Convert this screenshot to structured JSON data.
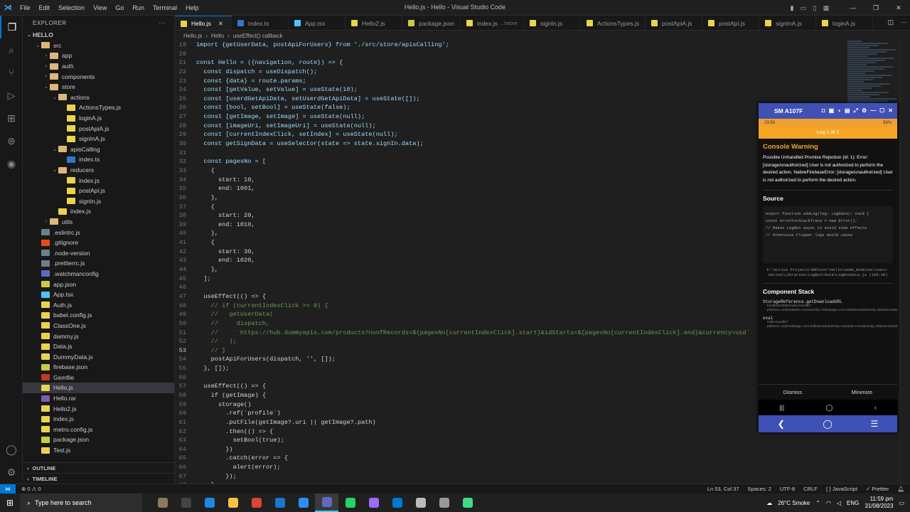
{
  "window": {
    "title": "Hello.js - Hello - Visual Studio Code",
    "menu": [
      "File",
      "Edit",
      "Selection",
      "View",
      "Go",
      "Run",
      "Terminal",
      "Help"
    ]
  },
  "explorer": {
    "header": "EXPLORER",
    "root": "HELLO",
    "items": [
      {
        "label": "src",
        "depth": 1,
        "type": "folder",
        "chev": "⌄"
      },
      {
        "label": "app",
        "depth": 2,
        "type": "folder",
        "chev": "›"
      },
      {
        "label": "auth",
        "depth": 2,
        "type": "folder",
        "chev": "›"
      },
      {
        "label": "components",
        "depth": 2,
        "type": "folder",
        "chev": "›"
      },
      {
        "label": "store",
        "depth": 2,
        "type": "folder",
        "chev": "⌄"
      },
      {
        "label": "actions",
        "depth": 3,
        "type": "folder",
        "chev": "⌄"
      },
      {
        "label": "ActionsTypes.js",
        "depth": 4,
        "type": "js"
      },
      {
        "label": "loginA.js",
        "depth": 4,
        "type": "js"
      },
      {
        "label": "postApiA.js",
        "depth": 4,
        "type": "js"
      },
      {
        "label": "signInA.js",
        "depth": 4,
        "type": "js"
      },
      {
        "label": "apisCalling",
        "depth": 3,
        "type": "folder",
        "chev": "⌄"
      },
      {
        "label": "index.ts",
        "depth": 4,
        "type": "ts"
      },
      {
        "label": "reducers",
        "depth": 3,
        "type": "folder",
        "chev": "⌄"
      },
      {
        "label": "index.js",
        "depth": 4,
        "type": "js"
      },
      {
        "label": "postApi.js",
        "depth": 4,
        "type": "js"
      },
      {
        "label": "signIn.js",
        "depth": 4,
        "type": "js"
      },
      {
        "label": "index.js",
        "depth": 3,
        "type": "js"
      },
      {
        "label": "utils",
        "depth": 2,
        "type": "folder",
        "chev": "›"
      },
      {
        "label": ".eslintrc.js",
        "depth": 1,
        "type": "cfg"
      },
      {
        "label": ".gitignore",
        "depth": 1,
        "type": "git"
      },
      {
        "label": ".node-version",
        "depth": 1,
        "type": "cfg"
      },
      {
        "label": ".prettierrc.js",
        "depth": 1,
        "type": "cfg"
      },
      {
        "label": ".watchmanconfig",
        "depth": 1,
        "type": "watch"
      },
      {
        "label": "app.json",
        "depth": 1,
        "type": "json"
      },
      {
        "label": "App.tsx",
        "depth": 1,
        "type": "tsx"
      },
      {
        "label": "Auth.js",
        "depth": 1,
        "type": "js"
      },
      {
        "label": "babel.config.js",
        "depth": 1,
        "type": "js"
      },
      {
        "label": "ClassOne.js",
        "depth": 1,
        "type": "js"
      },
      {
        "label": "dammy.js",
        "depth": 1,
        "type": "js"
      },
      {
        "label": "Data.js",
        "depth": 1,
        "type": "js"
      },
      {
        "label": "DummyData.js",
        "depth": 1,
        "type": "js"
      },
      {
        "label": "firebase.json",
        "depth": 1,
        "type": "json"
      },
      {
        "label": "Gemfile",
        "depth": 1,
        "type": "gem"
      },
      {
        "label": "Hello.js",
        "depth": 1,
        "type": "js",
        "selected": true
      },
      {
        "label": "Hello.rar",
        "depth": 1,
        "type": "rar"
      },
      {
        "label": "Hello2.js",
        "depth": 1,
        "type": "js"
      },
      {
        "label": "index.js",
        "depth": 1,
        "type": "js"
      },
      {
        "label": "metro.config.js",
        "depth": 1,
        "type": "js"
      },
      {
        "label": "package.json",
        "depth": 1,
        "type": "json"
      },
      {
        "label": "Test.js",
        "depth": 1,
        "type": "js"
      }
    ],
    "outline": "OUTLINE",
    "timeline": "TIMELINE"
  },
  "tabs": [
    {
      "label": "Hello.js",
      "type": "js",
      "active": true
    },
    {
      "label": "index.ts",
      "type": "ts"
    },
    {
      "label": "App.tsx",
      "type": "tsx"
    },
    {
      "label": "Hello2.js",
      "type": "js"
    },
    {
      "label": "package.json",
      "type": "json"
    },
    {
      "label": "index.js",
      "type": "js",
      "hint": "...\\store"
    },
    {
      "label": "signIn.js",
      "type": "js"
    },
    {
      "label": "ActionsTypes.js",
      "type": "js"
    },
    {
      "label": "postApiA.js",
      "type": "js"
    },
    {
      "label": "postApi.js",
      "type": "js"
    },
    {
      "label": "signInA.js",
      "type": "js"
    },
    {
      "label": "loginA.js",
      "type": "js"
    }
  ],
  "breadcrumb": [
    "Hello.js",
    "Hello",
    "useEffect() callback"
  ],
  "code": {
    "current_line": 53,
    "lines": [
      {
        "n": 19,
        "t": "import {getUserData, postApiForUsers} from './src/store/apisCalling';"
      },
      {
        "n": 20,
        "t": ""
      },
      {
        "n": 21,
        "t": "const Hello = ({navigation, route}) => {"
      },
      {
        "n": 22,
        "t": "  const dispatch = useDispatch();"
      },
      {
        "n": 23,
        "t": "  const {data} = route.params;"
      },
      {
        "n": 24,
        "t": "  const [getValue, setValue] = useState(10);"
      },
      {
        "n": 25,
        "t": "  const [userdGetApiData, setUserdGetApiData] = useState([]);"
      },
      {
        "n": 26,
        "t": "  const [bool, setBool] = useState(false);"
      },
      {
        "n": 27,
        "t": "  const [getImage, setImage] = useState(null);"
      },
      {
        "n": 28,
        "t": "  const [imageUri, setImageUri] = useState(null);"
      },
      {
        "n": 29,
        "t": "  const [currentIndexClick, setIndex] = useState(null);"
      },
      {
        "n": 30,
        "t": "  const getSignData = useSelector(state => state.signIn.data);"
      },
      {
        "n": 31,
        "t": ""
      },
      {
        "n": 32,
        "t": "  const pagesNo = ["
      },
      {
        "n": 33,
        "t": "    {"
      },
      {
        "n": 34,
        "t": "      start: 10,"
      },
      {
        "n": 35,
        "t": "      end: 1001,"
      },
      {
        "n": 36,
        "t": "    },"
      },
      {
        "n": 37,
        "t": "    {"
      },
      {
        "n": 38,
        "t": "      start: 20,"
      },
      {
        "n": 39,
        "t": "      end: 1010,"
      },
      {
        "n": 40,
        "t": "    },"
      },
      {
        "n": 41,
        "t": "    {"
      },
      {
        "n": 42,
        "t": "      start: 30,"
      },
      {
        "n": 43,
        "t": "      end: 1020,"
      },
      {
        "n": 44,
        "t": "    },"
      },
      {
        "n": 45,
        "t": "  ];"
      },
      {
        "n": 46,
        "t": ""
      },
      {
        "n": 47,
        "t": "  useEffect(() => {"
      },
      {
        "n": 48,
        "t": "    // if (currentIndexClick >= 0) {"
      },
      {
        "n": 49,
        "t": "    //   getUserData("
      },
      {
        "n": 50,
        "t": "    //     dispatch,"
      },
      {
        "n": 51,
        "t": "    //     `https://hub.dummyapis.com/products?noofRecords=${pagesNo[currentIndexClick].start}&idStarts=${pagesNo[currentIndexClick].end}&currency=usd`"
      },
      {
        "n": 52,
        "t": "    //   );"
      },
      {
        "n": 53,
        "t": "    // }"
      },
      {
        "n": 54,
        "t": "    postApiForUsers(dispatch, '', []);"
      },
      {
        "n": 55,
        "t": "  }, []);"
      },
      {
        "n": 56,
        "t": ""
      },
      {
        "n": 57,
        "t": "  useEffect(() => {"
      },
      {
        "n": 58,
        "t": "    if (getImage) {"
      },
      {
        "n": 59,
        "t": "      storage()"
      },
      {
        "n": 60,
        "t": "        .ref(`profile`)"
      },
      {
        "n": 61,
        "t": "        .putFile(getImage?.uri || getImage?.path)"
      },
      {
        "n": 62,
        "t": "        .then(() => {"
      },
      {
        "n": 63,
        "t": "          setBool(true);"
      },
      {
        "n": 64,
        "t": "        })"
      },
      {
        "n": 65,
        "t": "        .catch(error => {"
      },
      {
        "n": 66,
        "t": "          alert(error);"
      },
      {
        "n": 67,
        "t": "        });"
      },
      {
        "n": 68,
        "t": "    }"
      }
    ]
  },
  "emulator": {
    "title": "SM A107F",
    "status_time": "23:59",
    "status_battery": "56%",
    "log_banner": "Log 1 of 1",
    "warning_title": "Console Warning",
    "warning_message": "Possible Unhandled Promise Rejection (id: 1): Error: [storage/unauthorized] User is not authorized to perform the desired action. NativeFirebaseError: [storage/unauthorized] User is not authorized to perform the desired action.",
    "source_header": "Source",
    "source_lines": [
      "export function addLog(log: LogData): void {",
      "  const errorForStackTrace = new Error();",
      "",
      "  // Makes LogBox async to avoid side effects",
      "  // Otherwise Flipper logs would cause"
    ],
    "source_path": "E:\\Active Projects\\RNTutor\\Hello\\node_modules\\react-native\\Libraries\\LogBox\\Data\\LogBoxData.js (195:30)",
    "stack_header": "Component Stack",
    "stack": [
      {
        "fn": "StorageReference.getDownloadURL",
        "loc": "localhost:8081/index.bundle?platform=android&dev=true&minify=false&app=com.hello&modulesOnly=false&runModule=true:95043"
      },
      {
        "fn": "eval",
        "loc": "Hello.bundle?platform=android&app=com.hello&modulesOnly=true&dev=true&minify=false&runModule=true&shallow=true:75"
      }
    ],
    "dismiss": "Dismiss",
    "minimize": "Minimize"
  },
  "statusbar": {
    "problems": "⊗ 0  ⚠ 0",
    "position": "Ln 53, Col 37",
    "spaces": "Spaces: 2",
    "encoding": "UTF-8",
    "eol": "CRLF",
    "language": "{ } JavaScript",
    "prettier": "✓ Prettier"
  },
  "taskbar": {
    "search_placeholder": "Type here to search",
    "weather": "26°C  Smoke",
    "language": "ENG",
    "time": "11:59 pm",
    "date": "31/08/2023",
    "apps": [
      {
        "name": "widgets",
        "color": "#8a7a5a"
      },
      {
        "name": "task-view",
        "color": "#444"
      },
      {
        "name": "edge",
        "color": "#1e88e5"
      },
      {
        "name": "files",
        "color": "#f6c343"
      },
      {
        "name": "chrome",
        "color": "#db4437"
      },
      {
        "name": "store",
        "color": "#1976d2"
      },
      {
        "name": "zoom",
        "color": "#2d8cff"
      },
      {
        "name": "recorder",
        "color": "#5c6bc0",
        "active": true
      },
      {
        "name": "whatsapp",
        "color": "#25d366"
      },
      {
        "name": "app-circle",
        "color": "#9c6bff"
      },
      {
        "name": "vscode",
        "color": "#0078d4"
      },
      {
        "name": "tool",
        "color": "#bbb"
      },
      {
        "name": "settings",
        "color": "#999"
      },
      {
        "name": "android-studio",
        "color": "#3ddc84"
      }
    ]
  },
  "colors": {
    "accent": "#0078d4",
    "emulator_bar": "#3f51b5",
    "warning": "#f5a623"
  }
}
